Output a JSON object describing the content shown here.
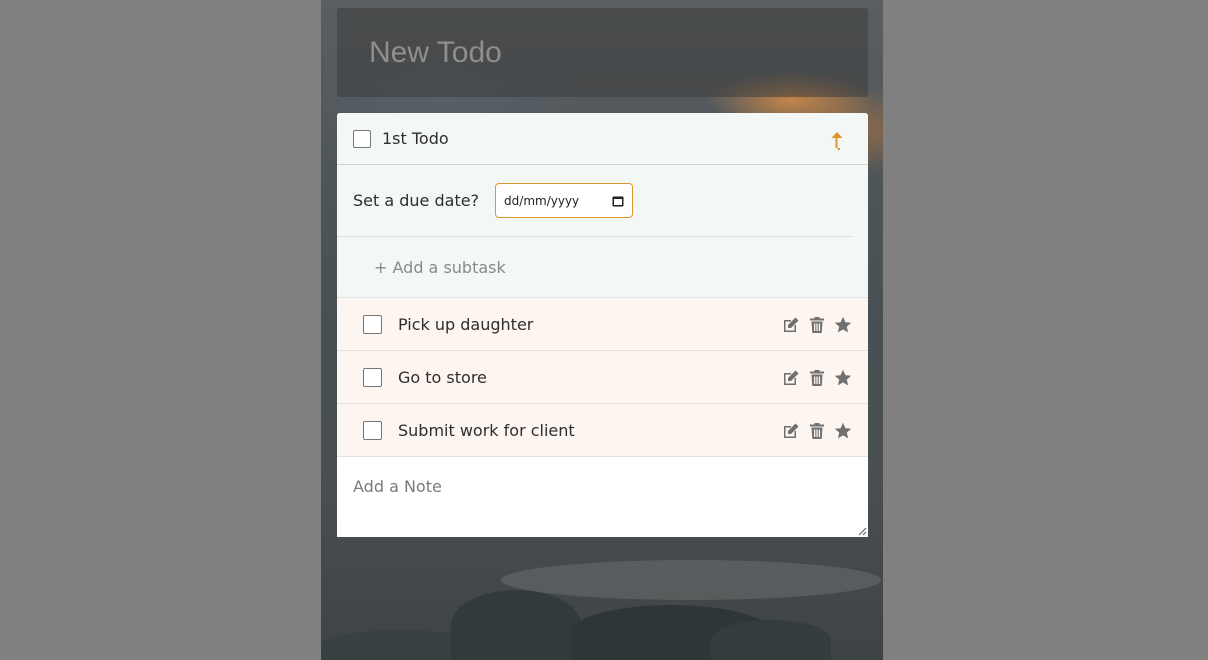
{
  "new_todo": {
    "placeholder": "New Todo"
  },
  "todo": {
    "title": "1st Todo",
    "due_label": "Set a due date?",
    "date_placeholder": "dd/mm/yyyy",
    "add_subtask": "+ Add a subtask",
    "subtasks": [
      {
        "label": "Pick up daughter"
      },
      {
        "label": "Go to store"
      },
      {
        "label": "Submit work for client"
      }
    ],
    "note_placeholder": "Add a Note"
  },
  "colors": {
    "accent": "#e0962f",
    "icon_gray": "#707070",
    "subtask_bg": "#fdf5ef",
    "header_bg": "#f3f7f6"
  },
  "icons": {
    "collapse": "arrow-up-icon",
    "edit": "edit-icon",
    "delete": "trash-icon",
    "favorite": "star-icon",
    "calendar": "calendar-icon"
  }
}
